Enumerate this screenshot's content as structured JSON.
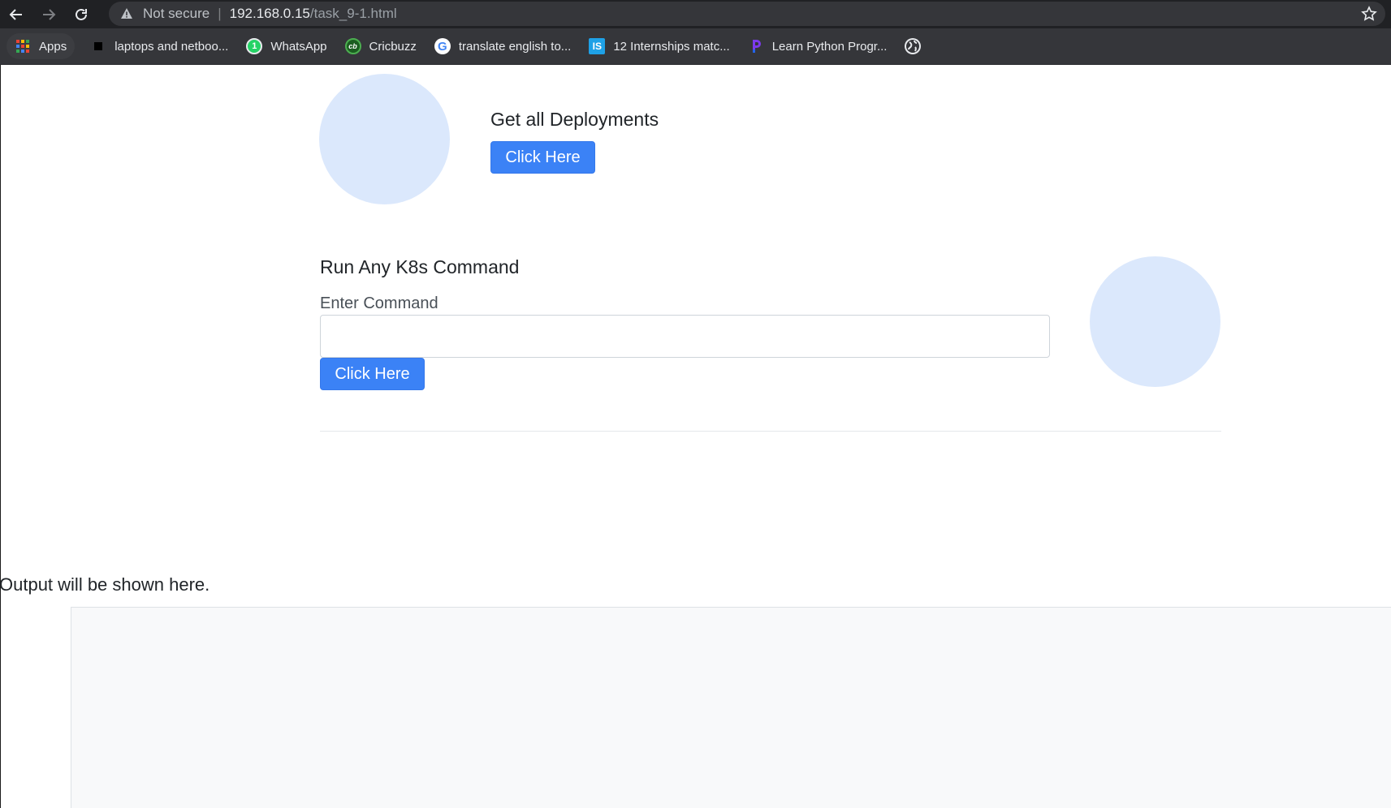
{
  "browser": {
    "security_label": "Not secure",
    "url_host": "192.168.0.15",
    "url_path": "/task_9-1.html",
    "bookmarks": [
      {
        "label": "Apps",
        "icon": "apps-grid-icon"
      },
      {
        "label": "laptops and netboo...",
        "icon": "black-square-icon"
      },
      {
        "label": "WhatsApp",
        "icon": "whatsapp-icon",
        "badge": "1"
      },
      {
        "label": "Cricbuzz",
        "icon": "cricbuzz-icon",
        "badge": "cb"
      },
      {
        "label": "translate english to...",
        "icon": "google-icon",
        "badge": "G"
      },
      {
        "label": "12 Internships matc...",
        "icon": "internshala-icon",
        "badge": "IS"
      },
      {
        "label": "Learn Python Progr...",
        "icon": "learn-python-icon"
      },
      {
        "label": "",
        "icon": "globe-icon"
      }
    ]
  },
  "deployments": {
    "title": "Get all Deployments",
    "button_label": "Click Here"
  },
  "k8s": {
    "title": "Run Any K8s Command",
    "input_label": "Enter Command",
    "input_value": "",
    "button_label": "Click Here"
  },
  "output": {
    "label": "Output will be shown here."
  },
  "colors": {
    "accent": "#3b82f6",
    "circle": "#dbe8fc",
    "output_bg": "#f8f9fa"
  }
}
